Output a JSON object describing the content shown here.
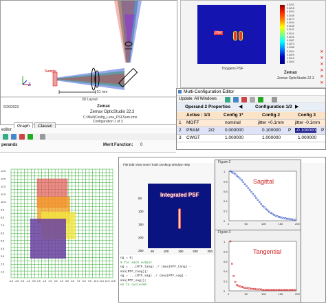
{
  "layout3d": {
    "scale_label": "51 mm",
    "caption": "3D Layout",
    "sample_label": "Sample",
    "footer_date": "6/26/2023",
    "footer_brand": "Zemax",
    "footer_product": "Zemax OpticStudio 22.3",
    "footer_file": "C:\\MultiConfig_Lens_PSFSum.zmx",
    "footer_config": "Configuration 1 of 3",
    "tabs": [
      "Graph",
      "Classic"
    ]
  },
  "psf_window": {
    "jitter_label": "jitter",
    "caption": "Huygens PSF",
    "brand": "Zemax",
    "product": "Zemax OpticStudio 22.3",
    "colorbar_values": [
      "0.0232",
      "0.0218",
      "0.0203",
      "0.0189",
      "0.0174",
      "0.0160",
      "0.0145",
      "0.0131",
      "0.0116",
      "0.0102",
      "0.0087",
      "0.0073",
      "0.0058",
      "0.0044",
      "0.0029",
      "0.0015",
      "0.0000"
    ]
  },
  "mce": {
    "title": "Multi-Configuration Editor",
    "update_label": "Update: All Windows",
    "operand_label": "Operand 2 Properties",
    "config_label": "Configuration 1/3",
    "headers": [
      "Active : 1/3",
      "Config 1*",
      "Config 2",
      "Config 3"
    ],
    "rows": [
      {
        "num": "1",
        "op": "MOFF",
        "arg": "",
        "c1": "nominal",
        "c2": "jitter +0.1mm",
        "c3": "jitter -0.1mm"
      },
      {
        "num": "2",
        "op": "PRAM",
        "arg": "2/2",
        "c1": "0.000000",
        "c2": "0.100000",
        "c2f": "P",
        "c3": "-0.100000",
        "c3f": "P"
      },
      {
        "num": "3",
        "op": "CWGT",
        "arg": "",
        "c1": "1.000000",
        "c2": "1.000000",
        "c3": "1.000000"
      }
    ]
  },
  "merit": {
    "editor_label": "editor",
    "operands_label": "perands",
    "merit_label": "Merit Function:",
    "merit_value": "0"
  },
  "grid_plot": {
    "y_ticks": [
      "14.5",
      "13.5",
      "12.5",
      "11.5",
      "10.5",
      "9.5",
      "8.5",
      "7.5",
      "6.5",
      "5.5",
      "4.5",
      "3.5",
      "2.5",
      "1.5"
    ],
    "x_ticks": [
      "-4.5",
      "-3.5",
      "-2.5",
      "-1.5",
      "-0.5",
      "0.5",
      "1.5",
      "2.5",
      "3.5",
      "4.5",
      "5.5",
      "6.5",
      "7.5",
      "8.5",
      "9.5",
      "10.5",
      "11.5",
      "12.5",
      "13.5"
    ]
  },
  "matlab": {
    "menu": [
      "File",
      "Edit",
      "View",
      "Insert",
      "Tools",
      "Desktop",
      "Window",
      "Help"
    ],
    "psf_title": "Integrated PSF",
    "psf_y_ticks": [
      "50",
      "100",
      "150",
      "200",
      "250"
    ],
    "psf_x_ticks": [
      "50",
      "100",
      "150",
      "200",
      "250"
    ],
    "code_lines": [
      "ng = 0;",
      "% for each output",
      "ng = ...(MTF_tang) ./ (max(MTF_tang) - min(MTF_tang));",
      "sg = ...(MTF_sag) ./ (max(MTF_sag) - min(MTF_sag));",
      "",
      "en to cycle/mm"
    ],
    "figure2": {
      "title": "Figure 2",
      "label": "Sagittal",
      "y_ticks": [
        "1",
        "0.8",
        "0.6",
        "0.4",
        "0.2",
        "0"
      ],
      "x_ticks": [
        "0",
        "50",
        "100",
        "150",
        "200"
      ]
    },
    "figure3": {
      "title": "Figure 3",
      "label": "Tangential",
      "y_ticks": [
        "1",
        "0.8",
        "0.6",
        "0.4",
        "0.2",
        "0"
      ],
      "x_ticks": [
        "0",
        "50",
        "100",
        "150",
        "200"
      ]
    }
  },
  "chart_data": [
    {
      "type": "scatter",
      "title": "",
      "series": [
        {
          "name": "",
          "values": [
            1.0,
            0.98,
            0.96,
            0.94,
            0.91,
            0.88,
            0.85,
            0.82,
            0.78,
            0.74,
            0.7,
            0.66,
            0.62,
            0.58,
            0.54,
            0.5,
            0.46,
            0.42,
            0.38,
            0.34,
            0.3,
            0.27,
            0.24,
            0.21,
            0.18,
            0.16,
            0.14,
            0.12,
            0.1,
            0.09,
            0.08,
            0.07,
            0.06,
            0.05,
            0.05,
            0.04,
            0.04,
            0.03,
            0.03,
            0.02,
            0.02
          ]
        }
      ],
      "xlim": [
        0,
        200
      ],
      "ylim": [
        0,
        1
      ]
    },
    {
      "type": "scatter",
      "title": "",
      "series": [
        {
          "name": "",
          "values": [
            1.0,
            0.55,
            0.3,
            0.18,
            0.12,
            0.1,
            0.09,
            0.08,
            0.07,
            0.06,
            0.06,
            0.05,
            0.05,
            0.04,
            0.04,
            0.04,
            0.03,
            0.03,
            0.03,
            0.03,
            0.02,
            0.02,
            0.02,
            0.02,
            0.02,
            0.02,
            0.02,
            0.02,
            0.02,
            0.02,
            0.02,
            0.02,
            0.02,
            0.02,
            0.02,
            0.02,
            0.02,
            0.02,
            0.02,
            0.02,
            0.02
          ]
        }
      ],
      "xlim": [
        0,
        200
      ],
      "ylim": [
        0,
        1
      ]
    }
  ]
}
